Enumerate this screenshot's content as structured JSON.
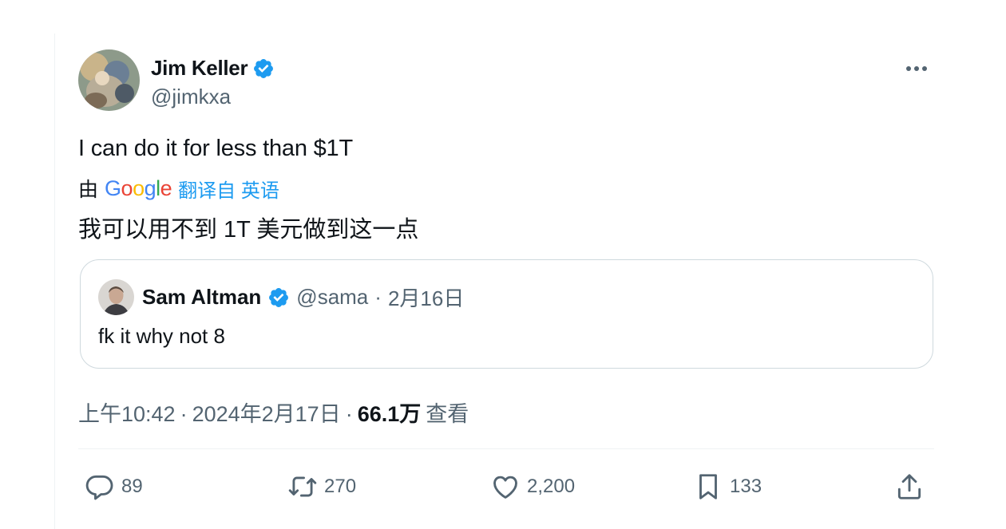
{
  "tweet": {
    "author": {
      "name": "Jim Keller",
      "handle": "@jimkxa"
    },
    "text": "I can do it for less than $1T",
    "translation": {
      "by_label": "由",
      "provider": "Google",
      "link_label": "翻译自 英语",
      "text": "我可以用不到 1T 美元做到这一点"
    },
    "quoted": {
      "name": "Sam Altman",
      "handle": "@sama",
      "dot": "·",
      "date": "2月16日",
      "text": "fk it why not 8"
    },
    "meta": {
      "time": "上午10:42",
      "dot1": "·",
      "date": "2024年2月17日",
      "dot2": "·",
      "views_count": "66.1万",
      "views_label": "查看"
    },
    "actions": {
      "replies": "89",
      "retweets": "270",
      "likes": "2,200",
      "bookmarks": "133"
    }
  },
  "colors": {
    "verified": "#1d9bf0",
    "link": "#1d9bf0",
    "secondary_text": "#536471",
    "primary_text": "#0f1419",
    "border": "#cfd9de"
  },
  "icons": [
    "verified-badge-icon",
    "more-icon",
    "reply-icon",
    "retweet-icon",
    "like-icon",
    "bookmark-icon",
    "share-icon"
  ]
}
